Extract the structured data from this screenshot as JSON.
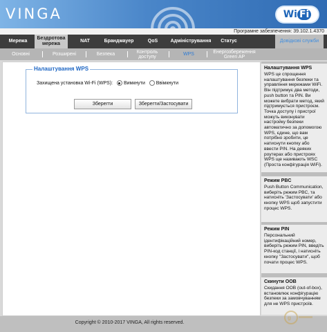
{
  "header": {
    "logo": "VINGA",
    "wifi_badge": {
      "part1": "Wi",
      "part2": "Fi"
    },
    "firmware": "Програмне забезпечення: 39.102.1.4370"
  },
  "main_nav": {
    "items": [
      "Мережа",
      "Бездротова мережа",
      "NAT",
      "Брандмауер",
      "QoS",
      "Адміністрування",
      "Статус"
    ],
    "help_link": "Довідкові служби",
    "active": "Бездротова мережа"
  },
  "sub_nav": {
    "items": [
      "Основні",
      "Розширені",
      "Безпека",
      "Контроль доступу",
      "WPS",
      "Енергозбереження Green AP"
    ],
    "active": "WPS"
  },
  "wps_panel": {
    "legend": "Налаштування WPS",
    "field_label": "Захищена установка Wi-Fi (WPS):",
    "options": [
      "Вимкнути",
      "Ввімкнути"
    ],
    "selected": "Вимкнути",
    "save_button": "Зберегти",
    "save_apply_button": "Зберегти/Застосувати"
  },
  "help_panel": {
    "sections": [
      {
        "title": "Налаштування WPS",
        "body": "WPS це спрощення налаштування безпеки та управління мережами WiFi. Він підтримує два методи, push button та PIN. Ви можете вибрати метод, який підтримується пристроєм. Точка доступу і пристрої можуть виконувати настройку безпеки автоматично за допомогою WPS, єдине, що вам потрібно зробити, це натиснути кнопку або ввести PIN. На деяких роутерах або пристроях WPS ще називають WSC (Проста конфігурація WiFi)."
      },
      {
        "title": "Режим PBC",
        "body": "Push Button Communication, виберіть режим PBC, та натисніть 'Застосувати' або кнопку WPS щоб запустити процес WPS."
      },
      {
        "title": "Режим PIN",
        "body": "Персональний ідентифікаційний номер, виберіть режим PIN, введіть PIN-код станції, і натисніть кнопку \"Застосувати\", щоб почати процес WPS."
      },
      {
        "title": "Скинути OOB",
        "body": "Скидання OOB (out-of-box), встановлює конфігурацію безпеки за замовчуванням для не WPS пристроїв."
      }
    ]
  },
  "footer": {
    "copyright": "Copyright © 2010-2017 VINGA, All rights reserved."
  },
  "colors": {
    "accent": "#1d66c4",
    "nav_bg": "#3d3d3d",
    "subnav_bg": "#b5b5b5",
    "header_blue": "#2f6bb3"
  }
}
